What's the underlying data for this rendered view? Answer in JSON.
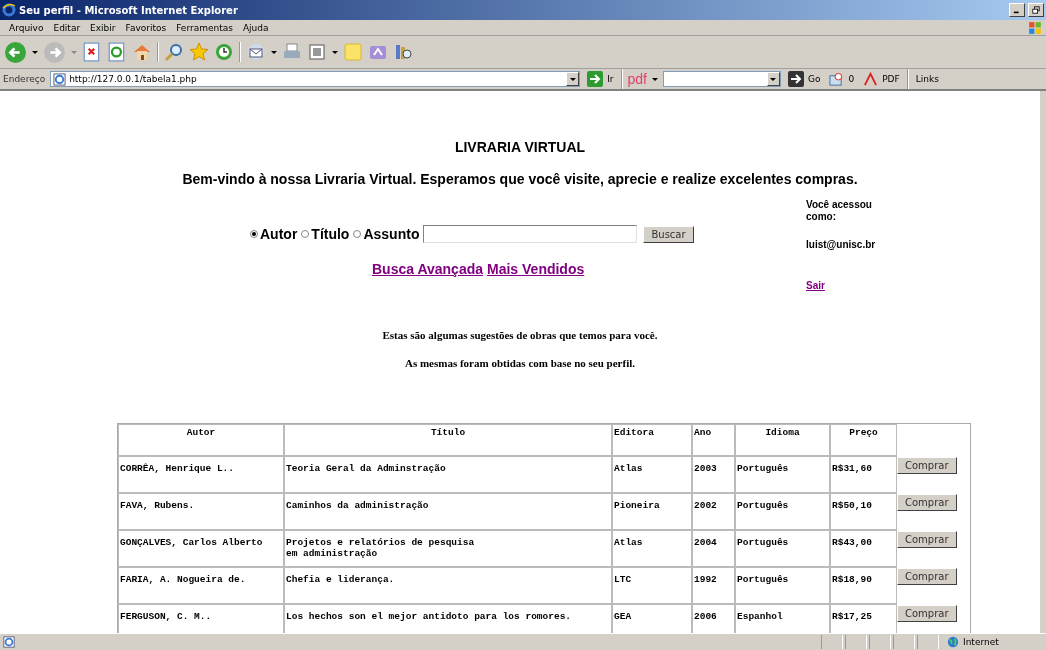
{
  "window": {
    "title": "Seu perfil - Microsoft Internet Explorer"
  },
  "menu": [
    "Arquivo",
    "Editar",
    "Exibir",
    "Favoritos",
    "Ferramentas",
    "Ajuda"
  ],
  "address_bar": {
    "label": "Endereço",
    "value": "http://127.0.0.1/tabela1.php",
    "go": "Ir"
  },
  "pdf_toolbar": {
    "logo": "pdf",
    "go": "Go",
    "count": "0",
    "pdf": "PDF",
    "links": "Links"
  },
  "page": {
    "heading": "LIVRARIA VIRTUAL",
    "welcome": "Bem-vindo à nossa Livraria Virtual. Esperamos que você visite, aprecie e realize excelentes compras.",
    "search_options": [
      {
        "label": "Autor",
        "selected": true
      },
      {
        "label": "Título",
        "selected": false
      },
      {
        "label": "Assunto",
        "selected": false
      }
    ],
    "search_button": "Buscar",
    "links": [
      "Busca Avançada",
      "Mais Vendidos"
    ],
    "user": {
      "label": "Você acessou como:",
      "email": "luist@unisc.br",
      "logout": "Sair"
    },
    "intro": [
      "Estas são algumas sugestões de obras que temos para você.",
      "As mesmas foram obtidas com base no seu perfil."
    ]
  },
  "table": {
    "columns": [
      "Autor",
      "Título",
      "Editora",
      "Ano",
      "Idioma",
      "Preço"
    ],
    "rows": [
      {
        "cells": [
          "CORRÊA, Henrique L..",
          "Teoria Geral da Adminstração",
          "Atlas",
          "2003",
          "Português",
          "R$31,60"
        ],
        "button": "Comprar"
      },
      {
        "cells": [
          "FAVA, Rubens.",
          "Caminhos da administração",
          "Pioneira",
          "2002",
          "Português",
          "R$50,10"
        ],
        "button": "Comprar"
      },
      {
        "cells": [
          "GONÇALVES, Carlos Alberto",
          "Projetos e relatórios de pesquisa\nem administração",
          "Atlas",
          "2004",
          "Português",
          "R$43,00"
        ],
        "button": "Comprar"
      },
      {
        "cells": [
          "FARIA, A. Nogueira de.",
          "Chefia e liderança.",
          "LTC",
          "1992",
          "Português",
          "R$18,90"
        ],
        "button": "Comprar"
      },
      {
        "cells": [
          "FERGUSON, C. M..",
          "Los hechos son el mejor antidoto para los romores.",
          "GEA",
          "2006",
          "Espanhol",
          "R$17,25"
        ],
        "button": "Comprar"
      }
    ]
  },
  "status_bar": {
    "zone": "Internet"
  }
}
